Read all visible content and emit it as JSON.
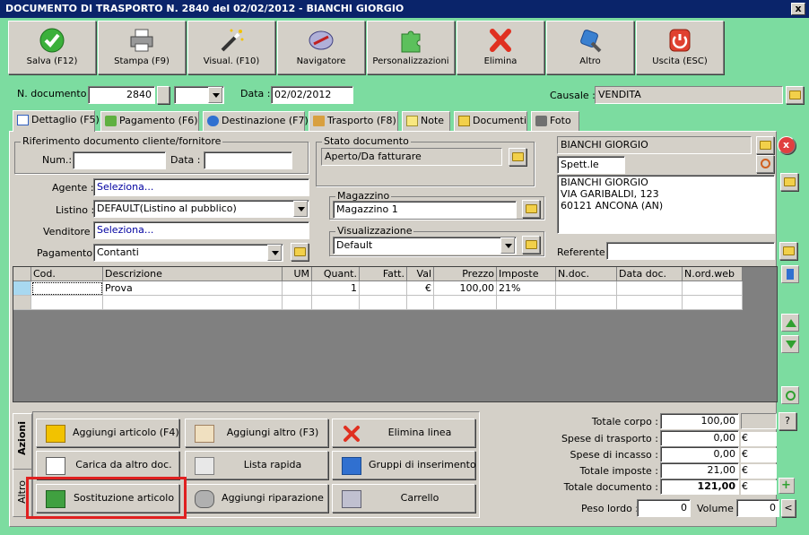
{
  "window": {
    "title": "DOCUMENTO DI TRASPORTO N. 2840 del 02/02/2012 - BIANCHI GIORGIO",
    "close": "x"
  },
  "toolbar": [
    {
      "label": "Salva (F12)",
      "icon": "save-check-icon"
    },
    {
      "label": "Stampa (F9)",
      "icon": "printer-icon"
    },
    {
      "label": "Visual. (F10)",
      "icon": "magic-wand-icon"
    },
    {
      "label": "Navigatore",
      "icon": "compass-icon"
    },
    {
      "label": "Personalizzazioni",
      "icon": "puzzle-icon"
    },
    {
      "label": "Elimina",
      "icon": "delete-x-icon"
    },
    {
      "label": "Altro",
      "icon": "tools-icon"
    },
    {
      "label": "Uscita (ESC)",
      "icon": "exit-power-icon"
    }
  ],
  "header": {
    "num_label": "N. documento :",
    "num_value": "2840",
    "data_label": "Data :",
    "data_value": "02/02/2012",
    "causale_label": "Causale :",
    "causale_value": "VENDITA"
  },
  "tabs": [
    {
      "label": "Dettaglio (F5)",
      "icon": "detail-icon",
      "active": true
    },
    {
      "label": "Pagamento (F6)",
      "icon": "payment-icon"
    },
    {
      "label": "Destinazione (F7)",
      "icon": "globe-icon"
    },
    {
      "label": "Trasporto (F8)",
      "icon": "truck-icon"
    },
    {
      "label": "Note",
      "icon": "note-icon"
    },
    {
      "label": "Documenti",
      "icon": "folder-icon"
    },
    {
      "label": "Foto",
      "icon": "camera-icon"
    }
  ],
  "rif": {
    "title": "Riferimento documento cliente/fornitore",
    "num_label": "Num.:",
    "num_value": "",
    "data_label": "Data :",
    "data_value": ""
  },
  "stato": {
    "title": "Stato documento",
    "value": "Aperto/Da fatturare"
  },
  "form": {
    "agente_label": "Agente :",
    "agente_value": "Seleziona...",
    "listino_label": "Listino :",
    "listino_value": "DEFAULT(Listino al pubblico)",
    "venditore_label": "Venditore :",
    "venditore_value": "Seleziona...",
    "pagamento_label": "Pagamento :",
    "pagamento_value": "Contanti"
  },
  "magazzino": {
    "title": "Magazzino",
    "value": "Magazzino 1"
  },
  "visualizzazione": {
    "title": "Visualizzazione",
    "value": "Default"
  },
  "cliente": {
    "name": "BIANCHI GIORGIO",
    "salutation": "Spett.le",
    "address": [
      "BIANCHI GIORGIO",
      "VIA GARIBALDI, 123",
      "60121 ANCONA (AN)"
    ],
    "referente_label": "Referente",
    "referente_value": ""
  },
  "grid": {
    "columns": [
      "Cod.",
      "Descrizione",
      "UM",
      "Quant.",
      "Fatt.",
      "Val",
      "Prezzo",
      "Imposte",
      "N.doc.",
      "Data doc.",
      "N.ord.web"
    ],
    "rows": [
      [
        "",
        "Prova",
        "",
        "1",
        "",
        "€",
        "100,00",
        "21%",
        "",
        "",
        ""
      ],
      [
        "",
        "",
        "",
        "",
        "",
        "",
        "",
        "",
        "",
        "",
        ""
      ]
    ]
  },
  "actions": {
    "tab_azioni": "Azioni",
    "tab_altro": "Altro",
    "buttons": [
      {
        "label": "Aggiungi articolo (F4)",
        "icon": "add-article-icon"
      },
      {
        "label": "Aggiungi altro (F3)",
        "icon": "add-other-icon"
      },
      {
        "label": "Elimina linea",
        "icon": "delete-line-icon"
      },
      {
        "label": "Carica da altro doc.",
        "icon": "load-doc-icon"
      },
      {
        "label": "Lista rapida",
        "icon": "quick-list-icon"
      },
      {
        "label": "Gruppi di inserimento",
        "icon": "insert-groups-icon"
      },
      {
        "label": "Sostituzione articolo",
        "icon": "replace-article-icon"
      },
      {
        "label": "Aggiungi riparazione",
        "icon": "wrench-icon"
      },
      {
        "label": "Carrello",
        "icon": "cart-icon"
      }
    ]
  },
  "totals": {
    "corpo_label": "Totale corpo :",
    "corpo_value": "100,00",
    "trasporto_label": "Spese di trasporto :",
    "trasporto_value": "0,00",
    "incasso_label": "Spese di incasso :",
    "incasso_value": "0,00",
    "imposte_label": "Totale imposte :",
    "imposte_value": "21,00",
    "documento_label": "Totale documento :",
    "documento_value": "121,00",
    "currency": "€",
    "help": "?",
    "peso_label": "Peso lordo :",
    "peso_value": "0",
    "volume_label": "Volume :",
    "volume_value": "0",
    "volume_btn": "<"
  },
  "colors": {
    "title_bg": "#0a246a",
    "frame_bg": "#7cdca0",
    "panel_bg": "#d4d0c8",
    "highlight": "#e02020"
  }
}
